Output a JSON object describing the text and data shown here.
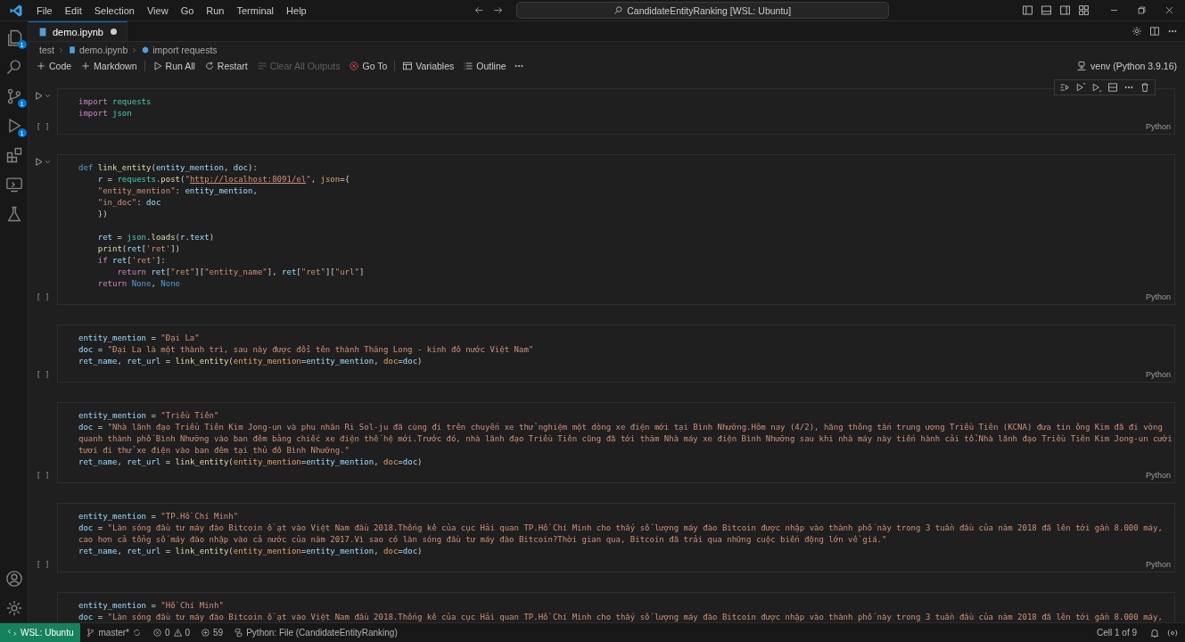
{
  "title_bar": {
    "menu": [
      "File",
      "Edit",
      "Selection",
      "View",
      "Go",
      "Run",
      "Terminal",
      "Help"
    ],
    "search": "CandidateEntityRanking [WSL: Ubuntu]"
  },
  "activity_bar": [
    {
      "kind": "files",
      "badge": "1"
    },
    {
      "kind": "search"
    },
    {
      "kind": "source-control",
      "badge": "1"
    },
    {
      "kind": "run",
      "badge": "1"
    },
    {
      "kind": "extensions"
    },
    {
      "kind": "remote"
    },
    {
      "kind": "testing"
    }
  ],
  "tabs": [
    {
      "label": "demo.ipynb",
      "selected": true,
      "modified": true
    }
  ],
  "breadcrumb": [
    {
      "kind": "folder",
      "label": "test"
    },
    {
      "kind": "notebook",
      "label": "demo.ipynb"
    },
    {
      "kind": "cell",
      "label": "import requests"
    }
  ],
  "toolbar": [
    [
      {
        "kind": "plus",
        "label": "Code",
        "disabled": false
      },
      {
        "kind": "plus",
        "label": "Markdown",
        "disabled": false
      }
    ],
    [
      {
        "kind": "run",
        "label": "Run All",
        "disabled": false
      },
      {
        "kind": "restart",
        "label": "Restart",
        "disabled": false
      },
      {
        "kind": "clear",
        "label": "Clear All Outputs",
        "disabled": true
      },
      {
        "kind": "goto",
        "label": "Go To",
        "disabled": false
      }
    ],
    [
      {
        "kind": "variables",
        "label": "Variables",
        "disabled": false
      },
      {
        "kind": "outline",
        "label": "Outline",
        "disabled": false
      },
      {
        "kind": "more"
      }
    ]
  ],
  "kernel": "venv (Python 3.9.16)",
  "cells": [
    {
      "show_run": true,
      "show_toolbar": true,
      "execution": "[ ]",
      "language": "Python",
      "lines": [
        {
          "tokens": [
            {
              "kind": "keyword",
              "text": "import"
            },
            {
              "kind": "module",
              "text": " requests"
            }
          ]
        },
        {
          "tokens": [
            {
              "kind": "keyword",
              "text": "import"
            },
            {
              "kind": "module",
              "text": " json"
            }
          ]
        }
      ]
    },
    {
      "show_run": true,
      "show_toolbar": false,
      "execution": "[ ]",
      "language": "Python",
      "lines": [
        {
          "tokens": [
            {
              "kind": "storage",
              "text": "def"
            },
            {
              "kind": "function",
              "text": " link_entity"
            },
            {
              "kind": "plain",
              "text": "("
            },
            {
              "kind": "variable",
              "text": "entity_mention"
            },
            {
              "kind": "plain",
              "text": ","
            },
            {
              "kind": "variable",
              "text": " doc"
            },
            {
              "kind": "plain",
              "text": "):"
            }
          ]
        },
        {
          "tokens": [
            {
              "kind": "variable",
              "text": "    r"
            },
            {
              "kind": "plain",
              "text": " ="
            },
            {
              "kind": "module",
              "text": " requests"
            },
            {
              "kind": "plain",
              "text": "."
            },
            {
              "kind": "function",
              "text": "post"
            },
            {
              "kind": "plain",
              "text": "("
            },
            {
              "kind": "string",
              "text": "\""
            },
            {
              "kind": "link",
              "text": "http://localhost:8091/el"
            },
            {
              "kind": "string",
              "text": "\""
            },
            {
              "kind": "plain",
              "text": ","
            },
            {
              "kind": "argument",
              "text": " json"
            },
            {
              "kind": "plain",
              "text": "={"
            }
          ]
        },
        {
          "tokens": [
            {
              "kind": "string",
              "text": "    \"entity_mention\""
            },
            {
              "kind": "plain",
              "text": ":"
            },
            {
              "kind": "variable",
              "text": " entity_mention"
            },
            {
              "kind": "plain",
              "text": ","
            }
          ]
        },
        {
          "tokens": [
            {
              "kind": "string",
              "text": "    \"in_doc\""
            },
            {
              "kind": "plain",
              "text": ":"
            },
            {
              "kind": "variable",
              "text": " doc"
            }
          ]
        },
        {
          "blank_after": true,
          "tokens": [
            {
              "kind": "plain",
              "text": "    })"
            }
          ]
        },
        {
          "tokens": [
            {
              "kind": "variable",
              "text": "    ret"
            },
            {
              "kind": "plain",
              "text": " ="
            },
            {
              "kind": "module",
              "text": " json"
            },
            {
              "kind": "plain",
              "text": "."
            },
            {
              "kind": "function",
              "text": "loads"
            },
            {
              "kind": "plain",
              "text": "("
            },
            {
              "kind": "variable",
              "text": "r"
            },
            {
              "kind": "plain",
              "text": "."
            },
            {
              "kind": "variable",
              "text": "text"
            },
            {
              "kind": "plain",
              "text": ")"
            }
          ]
        },
        {
          "tokens": [
            {
              "kind": "function",
              "text": "    print"
            },
            {
              "kind": "plain",
              "text": "("
            },
            {
              "kind": "variable",
              "text": "ret"
            },
            {
              "kind": "plain",
              "text": "["
            },
            {
              "kind": "string",
              "text": "'ret'"
            },
            {
              "kind": "plain",
              "text": "])"
            }
          ]
        },
        {
          "tokens": [
            {
              "kind": "keyword",
              "text": "    if"
            },
            {
              "kind": "variable",
              "text": " ret"
            },
            {
              "kind": "plain",
              "text": "["
            },
            {
              "kind": "string",
              "text": "'ret'"
            },
            {
              "kind": "plain",
              "text": "]:"
            }
          ]
        },
        {
          "tokens": [
            {
              "kind": "keyword",
              "text": "        return"
            },
            {
              "kind": "variable",
              "text": " ret"
            },
            {
              "kind": "plain",
              "text": "["
            },
            {
              "kind": "string",
              "text": "\"ret\""
            },
            {
              "kind": "plain",
              "text": "]["
            },
            {
              "kind": "string",
              "text": "\"entity_name\""
            },
            {
              "kind": "plain",
              "text": "],"
            },
            {
              "kind": "variable",
              "text": " ret"
            },
            {
              "kind": "plain",
              "text": "["
            },
            {
              "kind": "string",
              "text": "\"ret\""
            },
            {
              "kind": "plain",
              "text": "]["
            },
            {
              "kind": "string",
              "text": "\"url\""
            },
            {
              "kind": "plain",
              "text": "]"
            }
          ]
        },
        {
          "tokens": [
            {
              "kind": "keyword",
              "text": "    return"
            },
            {
              "kind": "constant",
              "text": " None"
            },
            {
              "kind": "plain",
              "text": ","
            },
            {
              "kind": "constant",
              "text": " None"
            }
          ]
        }
      ]
    },
    {
      "show_run": false,
      "show_toolbar": false,
      "execution": "[ ]",
      "language": "Python",
      "lines": [
        {
          "tokens": [
            {
              "kind": "variable",
              "text": "entity_mention"
            },
            {
              "kind": "plain",
              "text": " ="
            },
            {
              "kind": "string",
              "text": " \"Đại La\""
            }
          ]
        },
        {
          "tokens": [
            {
              "kind": "variable",
              "text": "doc"
            },
            {
              "kind": "plain",
              "text": " ="
            },
            {
              "kind": "string",
              "text": " \"Đại La là một thành trì, sau này được đổi tên thành Thăng Long - kinh đô nước Việt Nam\""
            }
          ]
        },
        {
          "tokens": [
            {
              "kind": "variable",
              "text": "ret_name"
            },
            {
              "kind": "plain",
              "text": ","
            },
            {
              "kind": "variable",
              "text": " ret_url"
            },
            {
              "kind": "plain",
              "text": " ="
            },
            {
              "kind": "function",
              "text": " link_entity"
            },
            {
              "kind": "plain",
              "text": "("
            },
            {
              "kind": "argument",
              "text": "entity_mention"
            },
            {
              "kind": "plain",
              "text": "="
            },
            {
              "kind": "variable",
              "text": "entity_mention"
            },
            {
              "kind": "plain",
              "text": ","
            },
            {
              "kind": "argument",
              "text": " doc"
            },
            {
              "kind": "plain",
              "text": "="
            },
            {
              "kind": "variable",
              "text": "doc"
            },
            {
              "kind": "plain",
              "text": ")"
            }
          ]
        }
      ]
    },
    {
      "show_run": false,
      "show_toolbar": false,
      "execution": "[ ]",
      "language": "Python",
      "lines": [
        {
          "tokens": [
            {
              "kind": "variable",
              "text": "entity_mention"
            },
            {
              "kind": "plain",
              "text": " ="
            },
            {
              "kind": "string",
              "text": " \"Triều Tiên\""
            }
          ]
        },
        {
          "tokens": [
            {
              "kind": "variable",
              "text": "doc"
            },
            {
              "kind": "plain",
              "text": " ="
            },
            {
              "kind": "string",
              "text": " \"Nhà lãnh đạo Triều Tiên Kim Jong-un và phu nhân Ri Sol-ju đã cùng đi trên chuyến xe thử nghiệm một dòng xe điện mới tại Bình Nhưỡng.Hôm nay (4/2), hãng thông tấn trung ương Triều Tiên (KCNA) đưa tin ông Kim đã đi vòng quanh thành phố Bình Nhưỡng vào ban đêm bằng chiếc xe điện thế hệ mới.Trước đó, nhà lãnh đạo Triều Tiên cũng đã tới thăm Nhà máy xe điện Bình Nhưỡng sau khi nhà máy này tiến hành cải tổ.Nhà lãnh đạo Triều Tiên Kim Jong-un cười tươi đi thử xe điện vào ban đêm tại thủ đô Bình Nhưỡng.\""
            }
          ]
        },
        {
          "tokens": [
            {
              "kind": "variable",
              "text": "ret_name"
            },
            {
              "kind": "plain",
              "text": ","
            },
            {
              "kind": "variable",
              "text": " ret_url"
            },
            {
              "kind": "plain",
              "text": " ="
            },
            {
              "kind": "function",
              "text": " link_entity"
            },
            {
              "kind": "plain",
              "text": "("
            },
            {
              "kind": "argument",
              "text": "entity_mention"
            },
            {
              "kind": "plain",
              "text": "="
            },
            {
              "kind": "variable",
              "text": "entity_mention"
            },
            {
              "kind": "plain",
              "text": ","
            },
            {
              "kind": "argument",
              "text": " doc"
            },
            {
              "kind": "plain",
              "text": "="
            },
            {
              "kind": "variable",
              "text": "doc"
            },
            {
              "kind": "plain",
              "text": ")"
            }
          ]
        }
      ]
    },
    {
      "show_run": false,
      "show_toolbar": false,
      "execution": "[ ]",
      "language": "Python",
      "lines": [
        {
          "tokens": [
            {
              "kind": "variable",
              "text": "entity_mention"
            },
            {
              "kind": "plain",
              "text": " ="
            },
            {
              "kind": "string",
              "text": " \"TP.Hồ Chí Minh\""
            }
          ]
        },
        {
          "tokens": [
            {
              "kind": "variable",
              "text": "doc"
            },
            {
              "kind": "plain",
              "text": " ="
            },
            {
              "kind": "string",
              "text": " \"Làn sóng đầu tư máy đào Bitcoin ồ ạt vào Việt Nam đầu 2018.Thống kê của cục Hải quan TP.Hồ Chí Minh cho thấy số lượng máy đào Bitcoin được nhập vào thành phố này trong 3 tuần đầu của năm 2018 đã lên tới gần 8.000 máy, cao hơn cả tổng số máy đào nhập vào cả nước của năm 2017.Vì sao có làn sóng đầu tư máy đào Bitcoin?Thời gian qua, Bitcoin đã trải qua những cuộc biến động lớn về giá.\""
            }
          ]
        },
        {
          "tokens": [
            {
              "kind": "variable",
              "text": "ret_name"
            },
            {
              "kind": "plain",
              "text": ","
            },
            {
              "kind": "variable",
              "text": " ret_url"
            },
            {
              "kind": "plain",
              "text": " ="
            },
            {
              "kind": "function",
              "text": " link_entity"
            },
            {
              "kind": "plain",
              "text": "("
            },
            {
              "kind": "argument",
              "text": "entity_mention"
            },
            {
              "kind": "plain",
              "text": "="
            },
            {
              "kind": "variable",
              "text": "entity_mention"
            },
            {
              "kind": "plain",
              "text": ","
            },
            {
              "kind": "argument",
              "text": " doc"
            },
            {
              "kind": "plain",
              "text": "="
            },
            {
              "kind": "variable",
              "text": "doc"
            },
            {
              "kind": "plain",
              "text": ")"
            }
          ]
        }
      ]
    },
    {
      "show_run": false,
      "show_toolbar": false,
      "lines": [
        {
          "tokens": [
            {
              "kind": "variable",
              "text": "entity_mention"
            },
            {
              "kind": "plain",
              "text": " ="
            },
            {
              "kind": "string",
              "text": " \"Hồ Chí Minh\""
            }
          ]
        },
        {
          "tokens": [
            {
              "kind": "variable",
              "text": "doc"
            },
            {
              "kind": "plain",
              "text": " ="
            },
            {
              "kind": "string",
              "text": " \"Làn sóng đầu tư máy đào Bitcoin ồ ạt vào Việt Nam đầu 2018.Thống kê của cục Hải quan TP.Hồ Chí Minh cho thấy số lượng máy đào Bitcoin được nhập vào thành phố này trong 3 tuần đầu của năm 2018 đã lên tới gần 8.000 máy,"
            }
          ]
        }
      ]
    }
  ],
  "status_bar": {
    "remote": "WSL: Ubuntu",
    "branch": "master*",
    "errors": "0",
    "warnings": "0",
    "ports": "59",
    "language": "Python: File (CandidateEntityRanking)",
    "cell": "Cell 1 of 9"
  }
}
